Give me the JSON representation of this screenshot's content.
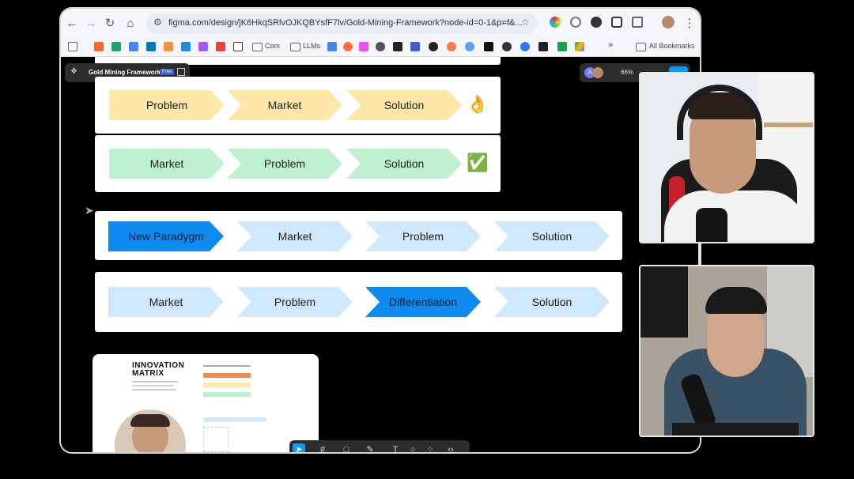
{
  "browser": {
    "url": "figma.com/design/jK6HkqSRlvOJKQBYsfF7lv/Gold-Mining-Framework?node-id=0-1&p=f&...",
    "bookmarks": [
      "Com",
      "LLMs"
    ],
    "all_bookmarks_label": "All Bookmarks"
  },
  "figma": {
    "file_name": "Gold Mining Framework",
    "plan_badge": "Free",
    "zoom": "66%",
    "avatar_initial": "A"
  },
  "frameworks": [
    {
      "steps": [
        "Problem",
        "Market",
        "Solution"
      ],
      "marker": "👌"
    },
    {
      "steps": [
        "Market",
        "Problem",
        "Solution"
      ],
      "marker": "✅"
    },
    {
      "steps": [
        "New Paradygm",
        "Market",
        "Problem",
        "Solution"
      ]
    },
    {
      "steps": [
        "Market",
        "Problem",
        "Differentiation",
        "Solution"
      ]
    }
  ],
  "thumbnail": {
    "title_line1": "INNOVATION",
    "title_line2": "MATRIX"
  },
  "colors": {
    "yellow": "#ffe7a8",
    "green": "#bff0cf",
    "light_blue": "#cfe8fc",
    "highlight_blue": "#0e8bf0"
  }
}
